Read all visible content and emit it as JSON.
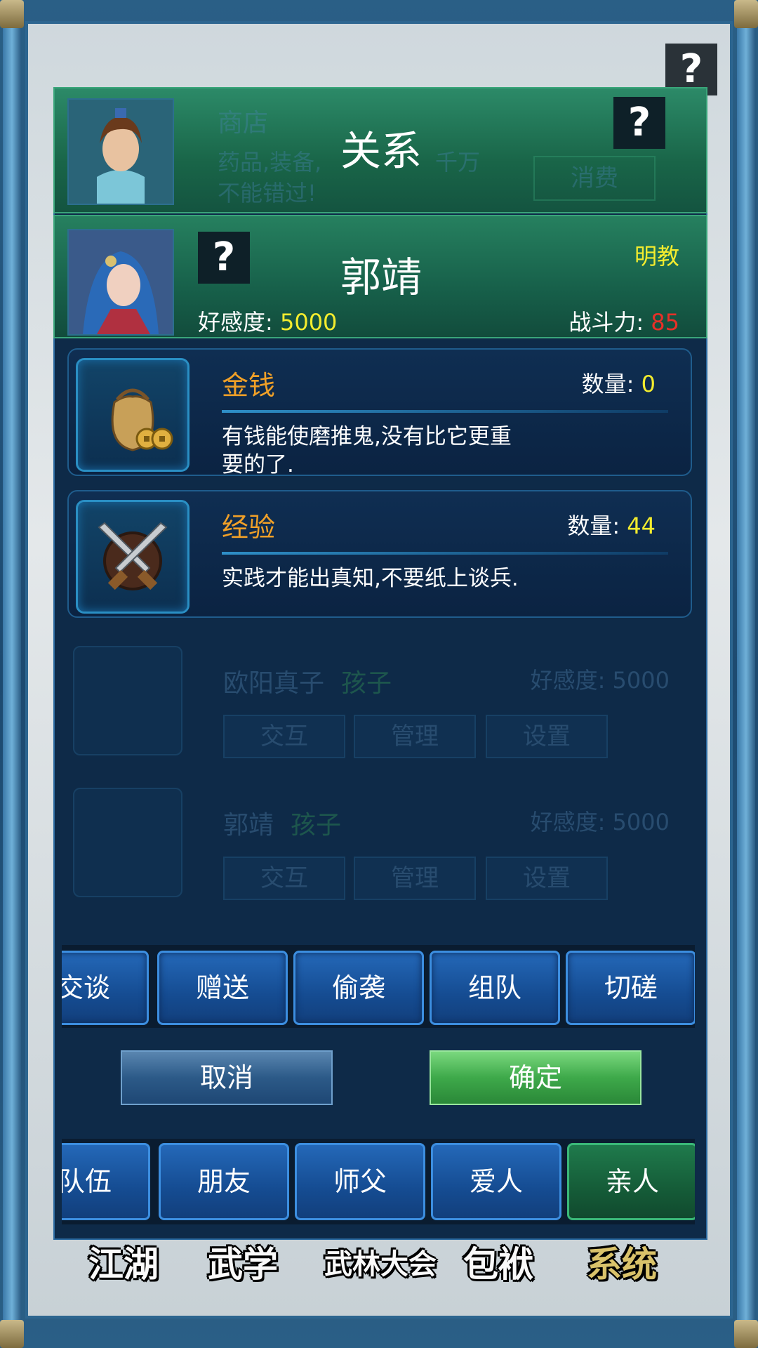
{
  "header": {
    "title": "关系",
    "bg_shop_name": "商店",
    "bg_shop_desc_1": "药品,装备,",
    "bg_shop_desc_1b": "千万",
    "bg_shop_desc_2": "不能错过!",
    "bg_shop_button": "消费"
  },
  "character": {
    "name": "郭靖",
    "sect": "明教",
    "favor_label": "好感度:",
    "favor_value": "5000",
    "power_label": "战斗力:",
    "power_value": "85"
  },
  "items": [
    {
      "name": "金钱",
      "qty_label": "数量:",
      "qty_value": "0",
      "desc": "有钱能使磨推鬼,没有比它更重要的了.",
      "icon": "money-bag-icon"
    },
    {
      "name": "经验",
      "qty_label": "数量:",
      "qty_value": "44",
      "desc": "实践才能出真知,不要纸上谈兵.",
      "icon": "crossed-swords-icon"
    }
  ],
  "background_list": [
    {
      "name": "欧阳真子",
      "tag": "孩子",
      "favor": "好感度: 5000",
      "b1": "交互",
      "b2": "管理",
      "b3": "设置"
    },
    {
      "name": "郭靖",
      "tag": "孩子",
      "favor": "好感度: 5000",
      "b1": "交互",
      "b2": "管理",
      "b3": "设置"
    }
  ],
  "actions": [
    "交谈",
    "赠送",
    "偷袭",
    "组队",
    "切磋"
  ],
  "dialog": {
    "cancel": "取消",
    "confirm": "确定"
  },
  "tabs": [
    "队伍",
    "朋友",
    "师父",
    "爱人",
    "亲人"
  ],
  "active_tab": "亲人",
  "bottom_nav": [
    "江湖",
    "武学",
    "武林大会",
    "包袱",
    "系统"
  ],
  "colors": {
    "header_green": "#196548",
    "panel_blue": "#0e2a48",
    "accent_orange": "#f0a028",
    "value_yellow": "#f3ec2e",
    "power_red": "#e63028"
  }
}
